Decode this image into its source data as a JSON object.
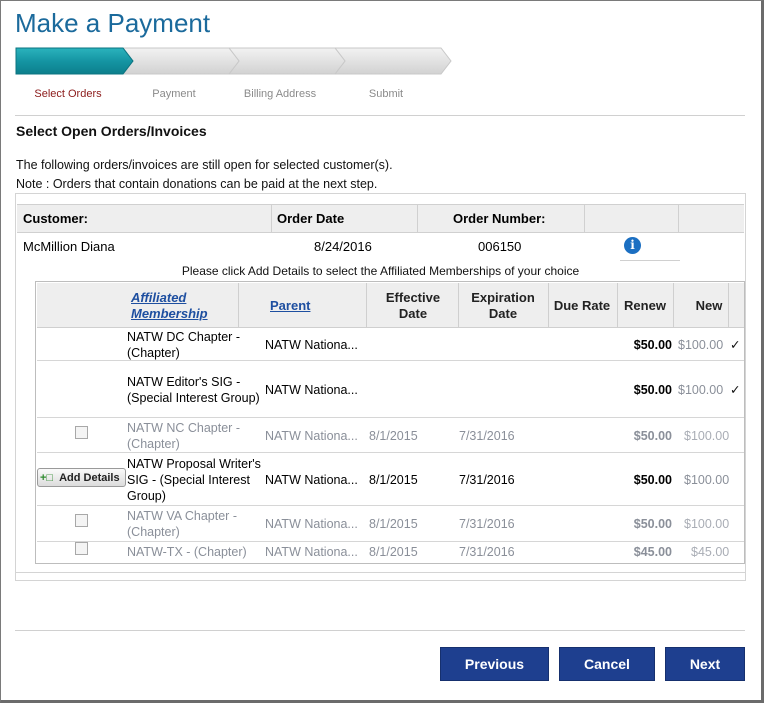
{
  "page": {
    "title": "Make a Payment"
  },
  "steps": [
    {
      "label": "Select Orders",
      "active": true
    },
    {
      "label": "Payment",
      "active": false
    },
    {
      "label": "Billing Address",
      "active": false
    },
    {
      "label": "Submit",
      "active": false
    }
  ],
  "section": {
    "title": "Select Open Orders/Invoices",
    "info1": "The following orders/invoices are still open for selected customer(s).",
    "info2": "Note : Orders that contain donations can be paid at the next step."
  },
  "customer_table": {
    "headers": {
      "customer": "Customer:",
      "order_date": "Order Date",
      "order_number": "Order Number:"
    },
    "row": {
      "customer": "McMillion Diana",
      "order_date": "8/24/2016",
      "order_number": "006150"
    },
    "info_icon": "info-icon"
  },
  "memberships": {
    "instruction": "Please click Add Details to select the Affiliated Memberships of your choice",
    "headers": {
      "affiliated": "Affiliated Membership",
      "parent": "Parent",
      "effective": "Effective Date",
      "expiration": "Expiration Date",
      "due_rate": "Due Rate",
      "renew": "Renew",
      "new": "New"
    },
    "rows": [
      {
        "name": "NATW DC Chapter - (Chapter)",
        "parent": "NATW Nationa...",
        "effective": "",
        "expiration": "",
        "renew": "$50.00",
        "new": "$100.00",
        "check": "✓"
      },
      {
        "name": "NATW Editor's SIG - (Special Interest Group)",
        "parent": "NATW Nationa...",
        "effective": "",
        "expiration": "",
        "renew": "$50.00",
        "new": "$100.00",
        "check": "✓"
      },
      {
        "name": "NATW NC Chapter - (Chapter)",
        "parent": "NATW Nationa...",
        "effective": "8/1/2015",
        "expiration": "7/31/2016",
        "renew": "$50.00",
        "new": "$100.00",
        "check": ""
      },
      {
        "name": "NATW Proposal Writer's SIG - (Special Interest Group)",
        "parent": "NATW Nationa...",
        "effective": "8/1/2015",
        "expiration": "7/31/2016",
        "renew": "$50.00",
        "new": "$100.00",
        "check": ""
      },
      {
        "name": "NATW VA Chapter - (Chapter)",
        "parent": "NATW Nationa...",
        "effective": "8/1/2015",
        "expiration": "7/31/2016",
        "renew": "$50.00",
        "new": "$100.00",
        "check": ""
      },
      {
        "name": "NATW-TX - (Chapter)",
        "parent": "NATW Nationa...",
        "effective": "8/1/2015",
        "expiration": "7/31/2016",
        "renew": "$45.00",
        "new": "$45.00",
        "check": ""
      }
    ],
    "add_details_label": "Add Details"
  },
  "buttons": {
    "previous": "Previous",
    "cancel": "Cancel",
    "next": "Next"
  },
  "colors": {
    "title": "#1b6a9c",
    "progress_active": "#1a9aa6",
    "progress_inactive": "#dcdcdc",
    "button": "#1e3f8f",
    "link": "#1e4fa0",
    "active_step": "#8b1a1a"
  }
}
